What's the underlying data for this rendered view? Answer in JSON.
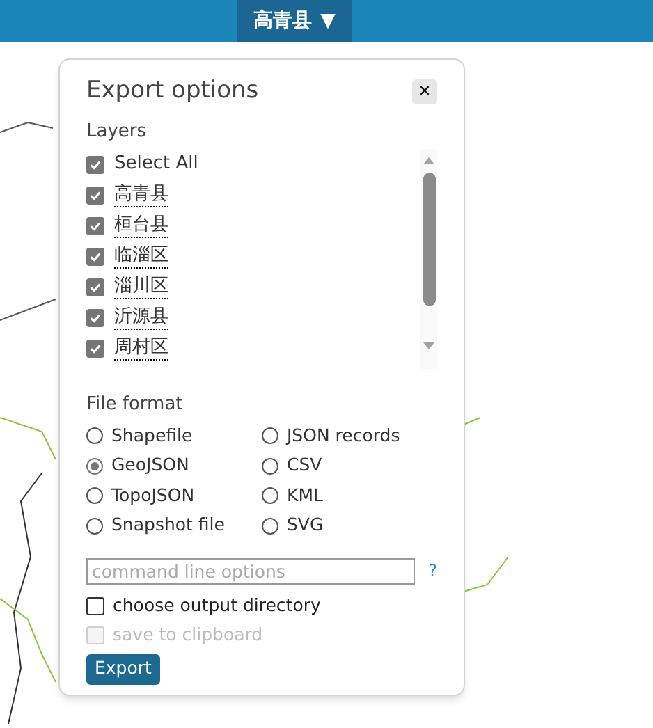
{
  "top_bar": {
    "layer_menu": {
      "label": "高青县",
      "caret": "▼"
    }
  },
  "dialog": {
    "title": "Export options",
    "close": "✕",
    "layers": {
      "label": "Layers",
      "select_all": {
        "label": "Select All",
        "checked": true
      },
      "items": [
        {
          "label": "高青县",
          "checked": true
        },
        {
          "label": "桓台县",
          "checked": true
        },
        {
          "label": "临淄区",
          "checked": true
        },
        {
          "label": "淄川区",
          "checked": true
        },
        {
          "label": "沂源县",
          "checked": true
        },
        {
          "label": "周村区",
          "checked": true
        }
      ]
    },
    "file_format": {
      "label": "File format",
      "options": [
        {
          "label": "Shapefile",
          "selected": false
        },
        {
          "label": "JSON records",
          "selected": false
        },
        {
          "label": "GeoJSON",
          "selected": true
        },
        {
          "label": "CSV",
          "selected": false
        },
        {
          "label": "TopoJSON",
          "selected": false
        },
        {
          "label": "KML",
          "selected": false
        },
        {
          "label": "Snapshot file",
          "selected": false
        },
        {
          "label": "SVG",
          "selected": false
        }
      ]
    },
    "command_line": {
      "placeholder": "command line options",
      "help": "?"
    },
    "options": [
      {
        "label": "choose output directory",
        "checked": false,
        "disabled": false
      },
      {
        "label": "save to clipboard",
        "checked": false,
        "disabled": true
      }
    ],
    "export_button": "Export"
  }
}
